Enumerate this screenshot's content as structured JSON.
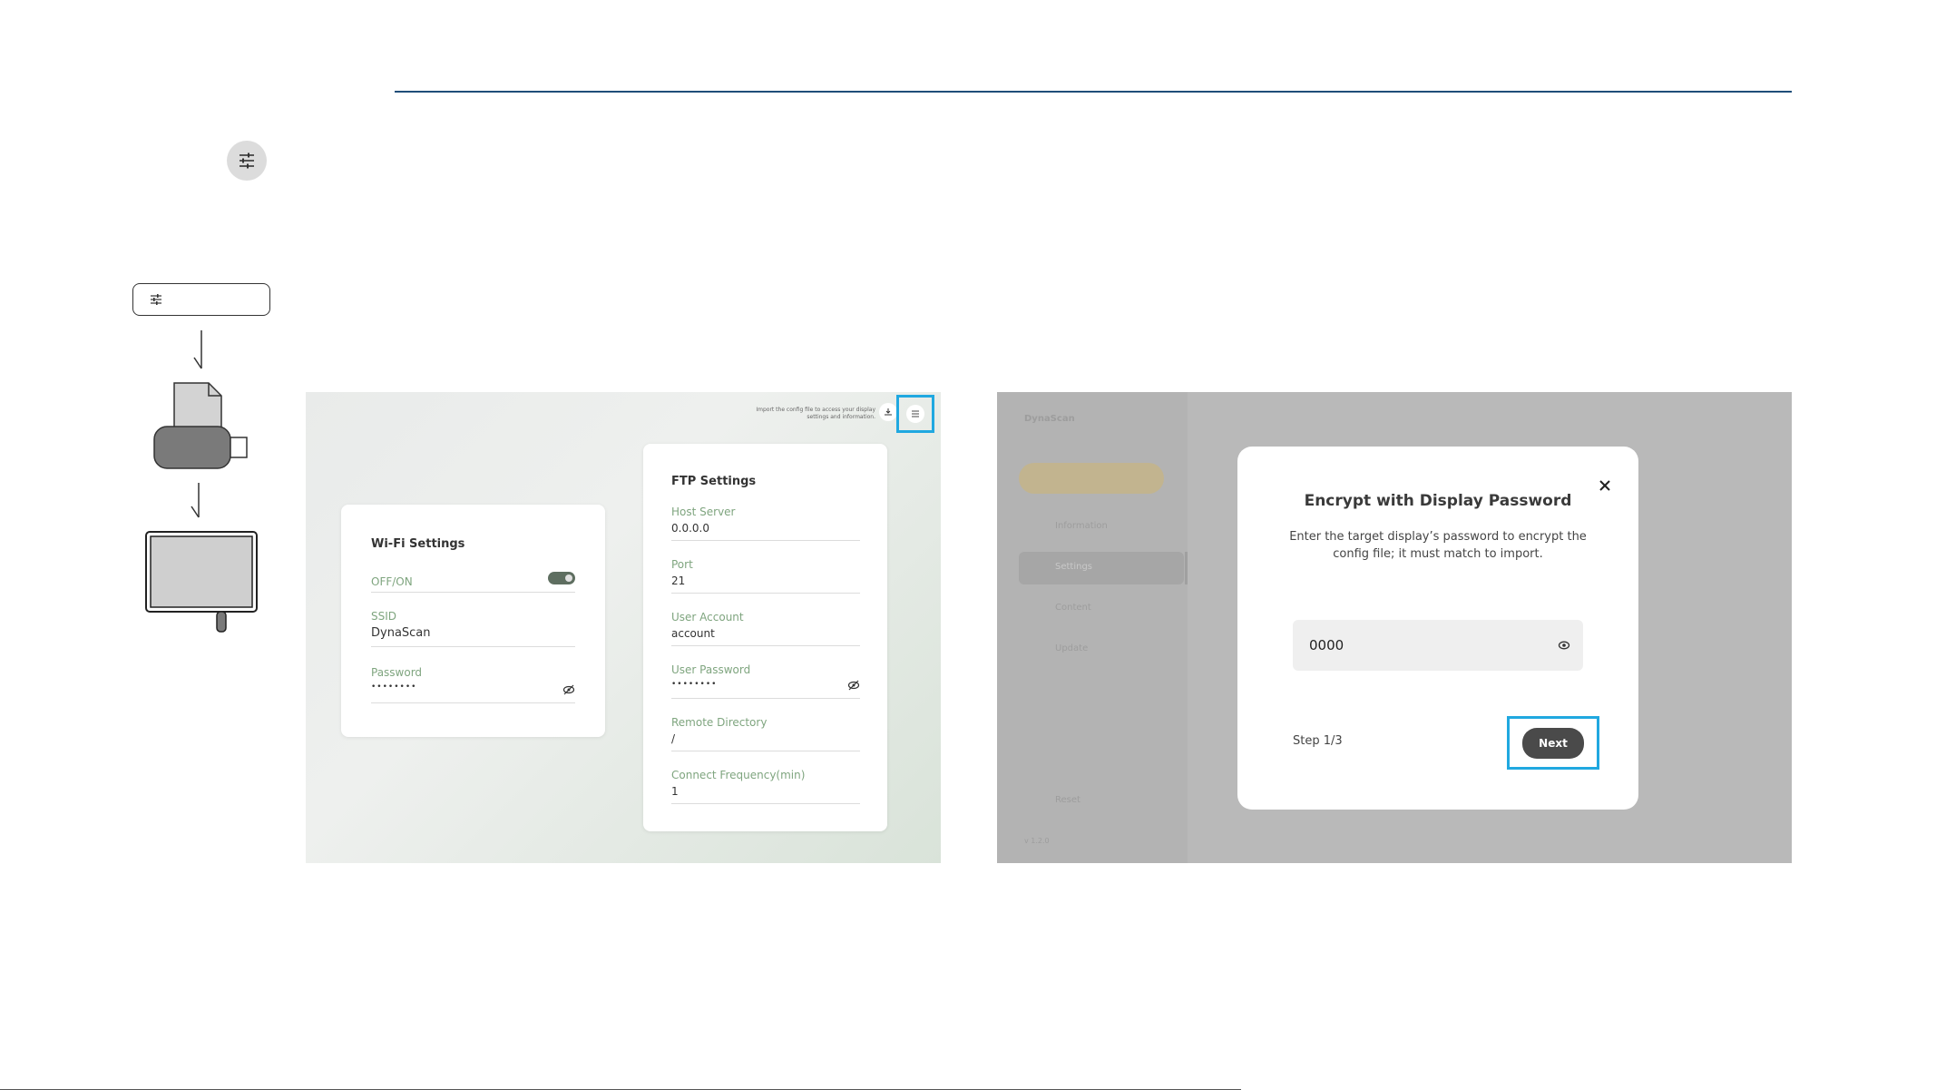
{
  "left_panel": {
    "hint": "Import the config file to access your display settings and information.",
    "wifi": {
      "title": "Wi-Fi Settings",
      "toggle_label": "OFF/ON",
      "toggle_on": true,
      "ssid_label": "SSID",
      "ssid_value": "DynaScan",
      "password_label": "Password",
      "password_value": "••••••••"
    },
    "ftp": {
      "title": "FTP Settings",
      "host_label": "Host Server",
      "host_value": "0.0.0.0",
      "port_label": "Port",
      "port_value": "21",
      "user_label": "User Account",
      "user_value": "account",
      "password_label": "User Password",
      "password_value": "••••••••",
      "dir_label": "Remote Directory",
      "dir_value": "/",
      "freq_label": "Connect Frequency(min)",
      "freq_value": "1"
    }
  },
  "right_panel": {
    "brand": "DynaScan",
    "sidebar_items": [
      "Information",
      "Settings",
      "Content",
      "Update"
    ],
    "reset_label": "Reset",
    "version": "v 1.2.0",
    "modal": {
      "title": "Encrypt with Display Password",
      "description_line1": "Enter the target display’s password to encrypt the",
      "description_line2": "config file; it must match to import.",
      "password_value": "0000",
      "step": "Step 1/3",
      "next_label": "Next"
    }
  },
  "colors": {
    "accent_rule": "#1f4e79",
    "highlight": "#20a8e0",
    "field_label": "#7fa57f"
  }
}
